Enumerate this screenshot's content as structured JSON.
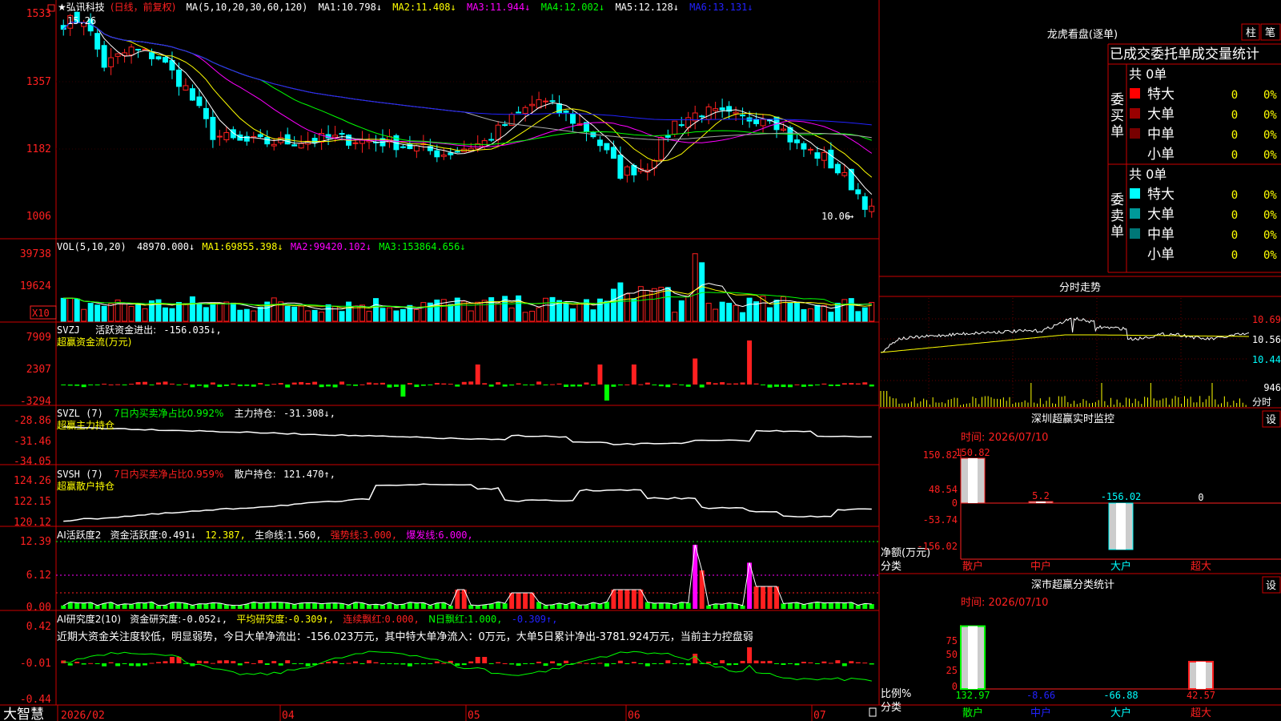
{
  "colors": {
    "up": "#ff2020",
    "down": "#00ffff",
    "frame": "#cc0000",
    "bg": "#000000",
    "ma1": "#ffffff",
    "ma2": "#ffff00",
    "ma3": "#ff00ff",
    "ma4": "#00ff00",
    "ma5": "#aaaaaa",
    "ma6": "#2222ff"
  },
  "main": {
    "stock": "★弘讯科技",
    "period": "(日线，前复权)",
    "ma_label": "MA(5,10,20,30,60,120)",
    "ma": [
      {
        "label": "MA1:",
        "value": "10.798↓"
      },
      {
        "label": "MA2:",
        "value": "11.408↓"
      },
      {
        "label": "MA3:",
        "value": "11.944↓"
      },
      {
        "label": "MA4:",
        "value": "12.002↓"
      },
      {
        "label": "MA5:",
        "value": "12.128↓"
      },
      {
        "label": "MA6:",
        "value": "13.131↓"
      }
    ],
    "y_ticks": [
      "1533",
      "1357",
      "1182",
      "1006"
    ],
    "y_values": [
      15.33,
      13.57,
      11.82,
      10.06
    ],
    "high_label": "15.26",
    "low_label": "10.06"
  },
  "vol": {
    "title": "VOL(5,10,20)",
    "value": "48970.000↓",
    "ma": [
      {
        "label": "MA1:",
        "value": "69855.398↓"
      },
      {
        "label": "MA2:",
        "value": "99420.102↓"
      },
      {
        "label": "MA3:",
        "value": "153864.656↓"
      }
    ],
    "y_ticks": [
      "39738",
      "19624"
    ],
    "unit": "X10"
  },
  "svzj": {
    "title": "SVZJ",
    "label": "活跃资金进出:",
    "value": "-156.035↓,",
    "sub": "超赢资金流(万元)",
    "y_ticks": [
      "7909",
      "2307",
      "-3294"
    ]
  },
  "svzl": {
    "title": "SVZL (7)",
    "label1": "7日内买卖净占比0.992%",
    "label2": "主力持仓:",
    "value": "-31.308↓,",
    "sub": "超赢主力持仓",
    "y_ticks": [
      "-28.86",
      "-31.46",
      "-34.05"
    ]
  },
  "svsh": {
    "title": "SVSH (7)",
    "label1": "7日内买卖净占比0.959%",
    "label2": "散户持仓:",
    "value": "121.470↑,",
    "sub": "超赢散户持仓",
    "y_ticks": [
      "124.26",
      "122.15",
      "120.12"
    ]
  },
  "ai1": {
    "title": "AI活跃度2",
    "items": [
      {
        "label": "资金活跃度:",
        "value": "0.491↓",
        "color": "#ffffff"
      },
      {
        "label": "",
        "value": "12.387,",
        "color": "#ffff00"
      },
      {
        "label": "生命线:",
        "value": "1.560,",
        "color": "#ffffff"
      },
      {
        "label": "强势线:",
        "value": "3.000,",
        "color": "#ff2020"
      },
      {
        "label": "爆发线:",
        "value": "6.000,",
        "color": "#ff00ff"
      }
    ],
    "y_ticks": [
      "12.39",
      "6.12",
      "0.00"
    ]
  },
  "ai2": {
    "title": "AI研究度2(10)",
    "items": [
      {
        "label": "资金研究度:",
        "value": "-0.052↓,",
        "color": "#ffffff"
      },
      {
        "label": "平均研究度:",
        "value": "-0.309↑,",
        "color": "#ffff00"
      },
      {
        "label": "连续飘红:",
        "value": "0.000,",
        "color": "#ff2020"
      },
      {
        "label": "N日飘红:",
        "value": "1.000,",
        "color": "#00ff00"
      },
      {
        "label": "",
        "value": "-0.309↑,",
        "color": "#2222ff"
      }
    ],
    "comment": "近期大资金关注度较低，明显弱势，今日大单净流出：-156.023万元，其中特大单净流入：0万元，大单5日累计净出-3781.924万元，当前主力控盘弱",
    "y_ticks": [
      "0.42",
      "-0.01",
      "-0.44"
    ]
  },
  "bottom": {
    "brand": "大智慧",
    "dates": [
      "2026/02",
      "04",
      "05",
      "06",
      "07"
    ]
  },
  "right": {
    "lhb_title": "龙虎看盘(逐单)",
    "btn1": "柱",
    "btn2": "笔",
    "table_title": "已成交委托单成交量统计",
    "buy": {
      "side": "委买单",
      "total": "共 0单",
      "rows": [
        {
          "name": "特大",
          "count": "0",
          "pct": "0%",
          "color": "#ff0000"
        },
        {
          "name": "大单",
          "count": "0",
          "pct": "0%",
          "color": "#990000"
        },
        {
          "name": "中单",
          "count": "0",
          "pct": "0%",
          "color": "#770000"
        },
        {
          "name": "小单",
          "count": "0",
          "pct": "0%",
          "color": "#000000"
        }
      ]
    },
    "sell": {
      "side": "委卖单",
      "total": "共 0单",
      "rows": [
        {
          "name": "特大",
          "count": "0",
          "pct": "0%",
          "color": "#00ffff"
        },
        {
          "name": "大单",
          "count": "0",
          "pct": "0%",
          "color": "#009999"
        },
        {
          "name": "中单",
          "count": "0",
          "pct": "0%",
          "color": "#007777"
        },
        {
          "name": "小单",
          "count": "0",
          "pct": "0%",
          "color": "#000000"
        }
      ]
    },
    "fs_title": "分时走势",
    "fs_y": [
      "10.69",
      "10.56",
      "10.44"
    ],
    "fs_vol": "946",
    "fs_vol_label": "分时",
    "mon_title": "深圳超赢实时监控",
    "set": "设",
    "mon_time": "时间: 2026/07/10",
    "mon_y": [
      "150.82",
      "48.54",
      "0",
      "-53.74",
      "-156.02"
    ],
    "mon_values": [
      {
        "cat": "散户",
        "value": "150.82",
        "color": "#ff2020"
      },
      {
        "cat": "中户",
        "value": "5.2",
        "color": "#ff2020"
      },
      {
        "cat": "大户",
        "value": "-156.02",
        "color": "#00ffff"
      },
      {
        "cat": "超大",
        "value": "0",
        "color": "#ffffff"
      }
    ],
    "mon_ylabel1": "净额(万元)",
    "mon_ylabel2": "分类",
    "cls_title": "深市超赢分类统计",
    "cls_time": "时间: 2026/07/10",
    "cls_y": [
      "75",
      "50",
      "25",
      "0"
    ],
    "cls_values": [
      {
        "cat": "散户",
        "value": "132.97",
        "color": "#00ff00"
      },
      {
        "cat": "中户",
        "value": "-8.66",
        "color": "#2222ff"
      },
      {
        "cat": "大户",
        "value": "-66.88",
        "color": "#00ffff"
      },
      {
        "cat": "超大",
        "value": "42.57",
        "color": "#ff2020"
      }
    ],
    "cls_ylabel1": "比例%",
    "cls_ylabel2": "分类"
  }
}
